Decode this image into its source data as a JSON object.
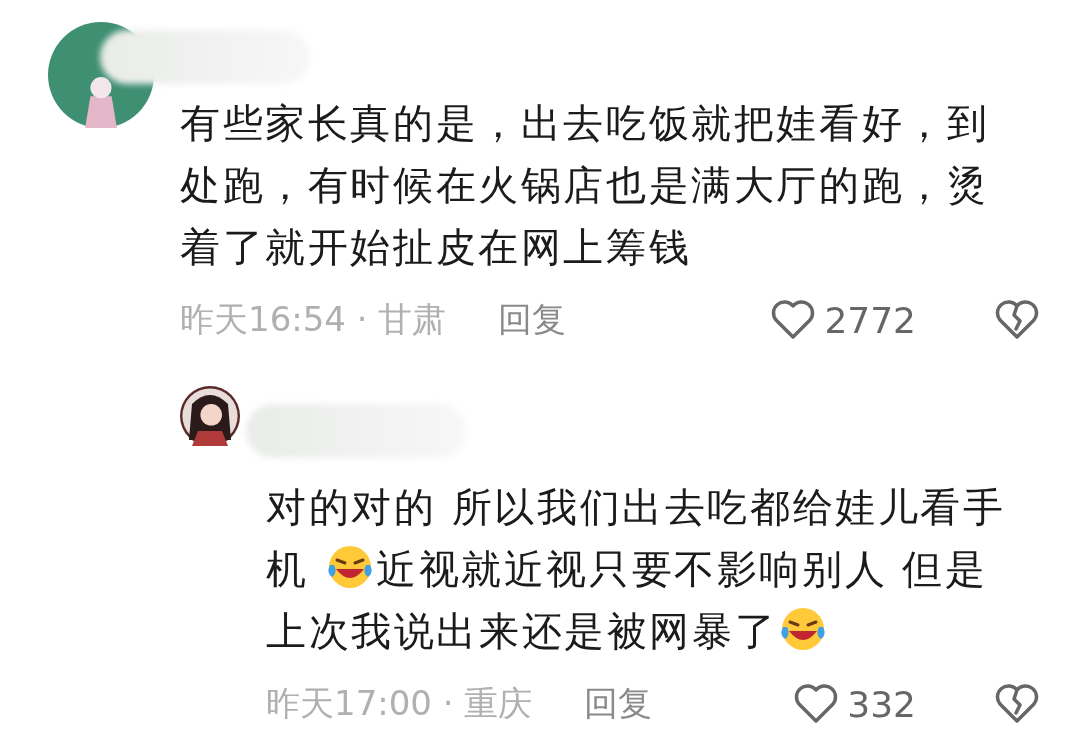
{
  "comments": [
    {
      "body": [
        {
          "kind": "text",
          "text": "有些家长真的是，出去吃饭就把娃看好，到处跑，有时候在火锅店也是满大厅的跑，烫着了就开始扯皮在网上筹钱"
        }
      ],
      "time": "昨天16:54",
      "separator": "·",
      "location": "甘肃",
      "reply": "回复",
      "likes": "2772",
      "reply_to": false
    },
    {
      "body": [
        {
          "kind": "text",
          "text": "对的对的 所以我们出去吃都给娃儿看手机 "
        },
        {
          "kind": "emoji"
        },
        {
          "kind": "text",
          "text": "近视就近视只要不影响别人 但是上次我说出来还是被网暴了"
        },
        {
          "kind": "emoji"
        }
      ],
      "time": "昨天17:00",
      "separator": "·",
      "location": "重庆",
      "reply": "回复",
      "likes": "332",
      "reply_to": true
    }
  ]
}
